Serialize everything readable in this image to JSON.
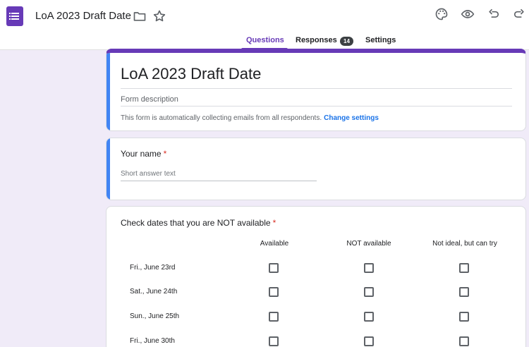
{
  "header": {
    "doc_title": "LoA 2023 Draft Date",
    "icons": [
      "forms-app-icon",
      "folder-icon",
      "star-icon",
      "palette-icon",
      "eye-icon",
      "undo-icon",
      "redo-icon"
    ]
  },
  "tabs": [
    {
      "label": "Questions",
      "active": true
    },
    {
      "label": "Responses",
      "active": false
    },
    {
      "label": "Settings",
      "active": false
    }
  ],
  "responses_count": "14",
  "form": {
    "title": "LoA 2023 Draft Date",
    "description_placeholder": "Form description",
    "collect_note": "This form is automatically collecting emails from all respondents.",
    "change_settings": "Change settings"
  },
  "questions": {
    "name": {
      "title": "Your name",
      "required_mark": "*",
      "answer_placeholder": "Short answer text"
    },
    "dates": {
      "title": "Check dates that you are NOT available",
      "required_mark": "*",
      "columns": [
        "Available",
        "NOT available",
        "Not ideal, but can try"
      ],
      "rows": [
        "Fri., June 23rd",
        "Sat., June 24th",
        "Sun., June 25th",
        "Fri., June 30th"
      ]
    }
  },
  "colors": {
    "accent": "#673ab7",
    "selected_bar": "#4285f4",
    "link": "#1a73e8",
    "required": "#d93025",
    "background": "#f0ebf8"
  }
}
